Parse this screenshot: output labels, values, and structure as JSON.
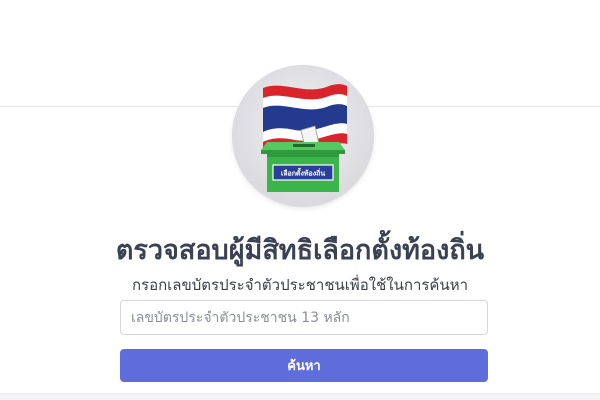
{
  "logo": {
    "icon": "ballot-box-thai-flag-icon",
    "box_label": "เลือกตั้งท้องถิ่น",
    "colors": {
      "flag_red": "#d9242b",
      "flag_white": "#ffffff",
      "flag_blue": "#233a8e",
      "box_green": "#3bb54a",
      "box_label_bg": "#2a3f9a"
    }
  },
  "header": {
    "title": "ตรวจสอบผู้มีสิทธิเลือกตั้งท้องถิ่น",
    "subtitle": "กรอกเลขบัตรประจำตัวประชาชนเพื่อใช้ในการค้นหา"
  },
  "form": {
    "id_input": {
      "value": "",
      "placeholder": "เลขบัตรประจำตัวประชาชน 13 หลัก"
    },
    "search_button_label": "ค้นหา"
  },
  "colors": {
    "accent": "#5f6ddb",
    "title_text": "#3b4153"
  }
}
